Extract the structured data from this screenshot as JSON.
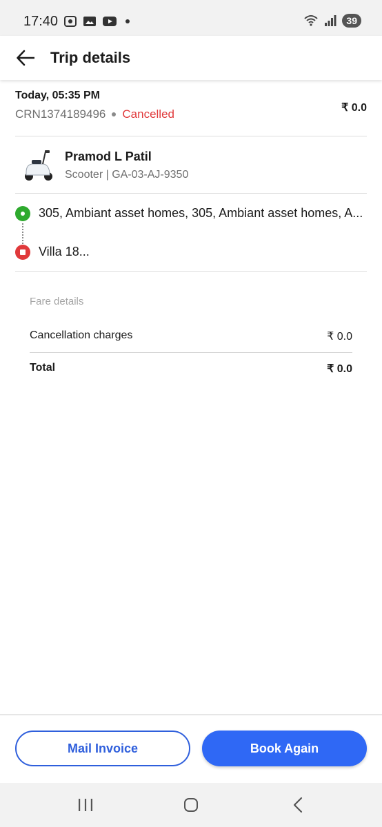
{
  "status_bar": {
    "time": "17:40",
    "battery": "39",
    "icons": [
      "screenshot-icon",
      "gallery-icon",
      "youtube-icon",
      "dot-icon",
      "wifi-icon",
      "signal-icon"
    ]
  },
  "header": {
    "title": "Trip details",
    "back_icon": "arrow-left-icon"
  },
  "trip": {
    "datetime": "Today, 05:35 PM",
    "crn": "CRN1374189496",
    "status": "Cancelled",
    "amount": "₹ 0.0",
    "status_color": "#e0393b"
  },
  "driver": {
    "name": "Pramod L Patil",
    "vehicle": "Scooter | GA-03-AJ-9350",
    "vehicle_icon": "scooter-icon"
  },
  "route": {
    "pickup": "305, Ambiant asset homes, 305, Ambiant asset homes, A...",
    "drop": "Villa 18..."
  },
  "fare": {
    "title": "Fare details",
    "rows": [
      {
        "label": "Cancellation charges",
        "value": "₹ 0.0"
      }
    ],
    "total_label": "Total",
    "total_value": "₹ 0.0"
  },
  "actions": {
    "mail_invoice": "Mail Invoice",
    "book_again": "Book Again"
  },
  "colors": {
    "primary": "#2f68f5",
    "pickup": "#2eaa2e",
    "drop": "#e0393b"
  }
}
